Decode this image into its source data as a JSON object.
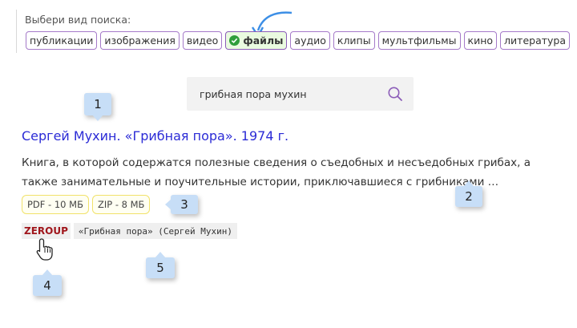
{
  "search_type": {
    "label": "Выбери вид поиска:",
    "chips": [
      {
        "label": "публикации",
        "active": false
      },
      {
        "label": "изображения",
        "active": false
      },
      {
        "label": "видео",
        "active": false
      },
      {
        "label": "файлы",
        "active": true
      },
      {
        "label": "аудио",
        "active": false
      },
      {
        "label": "клипы",
        "active": false
      },
      {
        "label": "мультфильмы",
        "active": false
      },
      {
        "label": "кино",
        "active": false
      },
      {
        "label": "литература",
        "active": false
      }
    ]
  },
  "search": {
    "value": "грибная пора мухин"
  },
  "result": {
    "title": "Сергей Мухин. «Грибная пора». 1974 г.",
    "description": "Книга, в которой содержатся полезные сведения о съедобных и несъедобных грибах, а также занимательные и поучительные истории, приключавшиеся с грибниками …",
    "downloads": [
      {
        "label": "PDF - 10 МБ"
      },
      {
        "label": "ZIP - 8 МБ"
      }
    ],
    "tag": "ZEROUP",
    "code": "«Грибная пора» (Сергей Мухин)"
  },
  "callouts": {
    "c1": "1",
    "c2": "2",
    "c3": "3",
    "c4": "4",
    "c5": "5"
  },
  "colors": {
    "accent": "#2b2bd6",
    "chip_border": "#a57ac9",
    "active_chip_bg": "#eafbe0",
    "badge_border": "#f1e26a",
    "callout_bg": "#c7def7",
    "tag_color": "#a0161c"
  }
}
